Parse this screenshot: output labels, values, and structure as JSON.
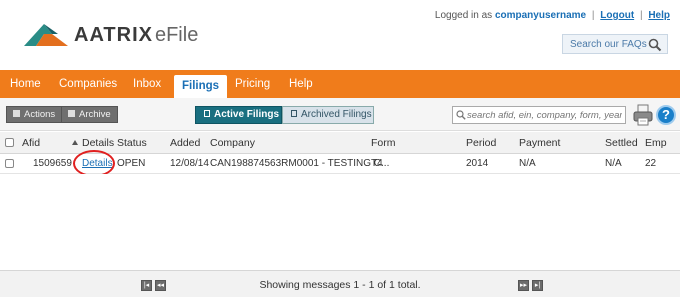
{
  "brand": {
    "name_bold": "AATRIX",
    "name_light": "eFile"
  },
  "user_bar": {
    "logged_in_text": "Logged in as",
    "username": "companyusername",
    "separator": "|",
    "logout": "Logout",
    "help": "Help"
  },
  "faq": {
    "placeholder": "Search our FAQs",
    "icon": "magnifier-icon"
  },
  "nav": {
    "items": [
      {
        "label": "Home"
      },
      {
        "label": "Companies"
      },
      {
        "label": "Inbox"
      },
      {
        "label": "Filings",
        "active": true
      },
      {
        "label": "Pricing"
      },
      {
        "label": "Help"
      }
    ],
    "color": "#f07c1b"
  },
  "toolbar": {
    "actions_label": "Actions",
    "archive_label": "Archive",
    "active_filings_label": "Active Filings",
    "archived_filings_label": "Archived Filings",
    "search_placeholder": "search afid, ein, company, form, year",
    "help_glyph": "?"
  },
  "table": {
    "columns": [
      "Afid",
      "Details",
      "Status",
      "Added",
      "Company",
      "Form",
      "Period",
      "Payment",
      "Settled",
      "Emp"
    ],
    "sorted_column": "Afid",
    "rows": [
      {
        "afid": "1509659",
        "details": "Details",
        "status": "OPEN",
        "added": "12/08/14",
        "company": "CAN198874563RM0001 - TESTING C...",
        "form": "T4",
        "period": "2014",
        "payment": "N/A",
        "settled": "N/A",
        "emp": "22"
      }
    ]
  },
  "footer": {
    "status": "Showing messages 1 - 1 of 1 total.",
    "first_glyph": "|◂",
    "prev_glyph": "◂◂",
    "next_glyph": "▸▸",
    "last_glyph": "▸|"
  },
  "highlight_color": "#e02020"
}
